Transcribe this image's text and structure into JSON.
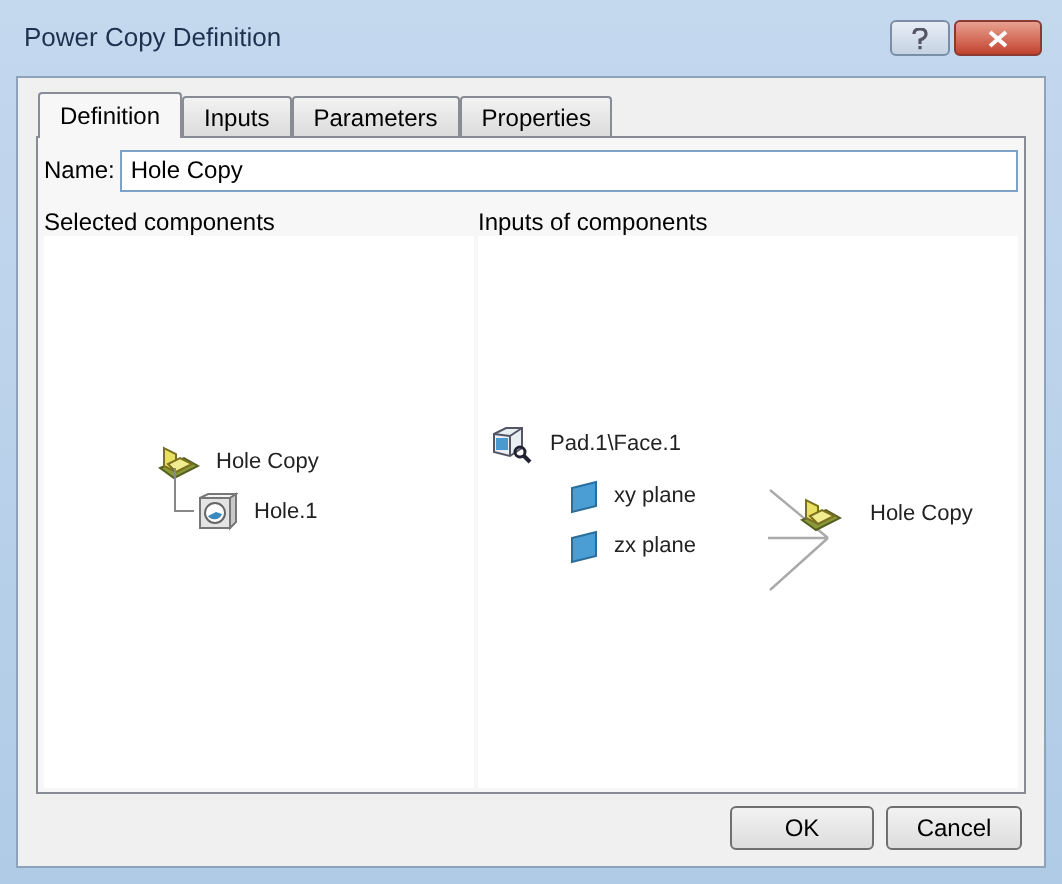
{
  "window": {
    "title": "Power Copy Definition"
  },
  "tabs": [
    {
      "label": "Definition",
      "selected": true
    },
    {
      "label": "Inputs",
      "selected": false
    },
    {
      "label": "Parameters",
      "selected": false
    },
    {
      "label": "Properties",
      "selected": false
    }
  ],
  "name_field": {
    "label": "Name:",
    "value": "Hole Copy"
  },
  "selected_components": {
    "header": "Selected components",
    "tree": [
      {
        "label": "Hole Copy",
        "kind": "powercopy",
        "children": [
          {
            "label": "Hole.1",
            "kind": "hole"
          }
        ]
      }
    ]
  },
  "inputs_of_components": {
    "header": "Inputs of components",
    "inputs": [
      {
        "label": "Pad.1\\Face.1",
        "kind": "face"
      },
      {
        "label": "xy plane",
        "kind": "plane"
      },
      {
        "label": "zx plane",
        "kind": "plane"
      }
    ],
    "output": {
      "label": "Hole Copy",
      "kind": "powercopy"
    }
  },
  "buttons": [
    "OK",
    "Cancel"
  ]
}
